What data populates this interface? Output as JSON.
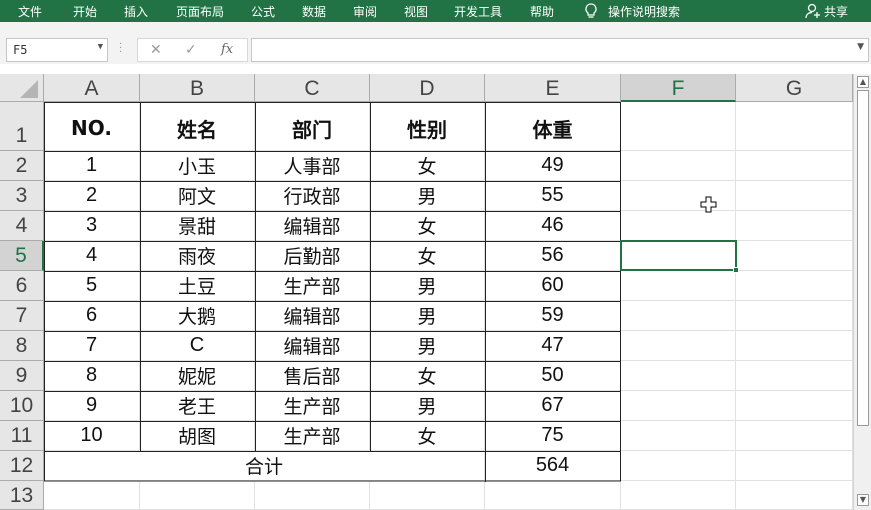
{
  "ribbon": {
    "tabs": [
      "文件",
      "开始",
      "插入",
      "页面布局",
      "公式",
      "数据",
      "审阅",
      "视图",
      "开发工具",
      "帮助"
    ],
    "search_label": "操作说明搜索",
    "share_label": "共享"
  },
  "formula_bar": {
    "name_box": "F5",
    "cancel_glyph": "✕",
    "enter_glyph": "✓",
    "function_glyph": "fx",
    "formula": ""
  },
  "grid": {
    "columns": [
      "A",
      "B",
      "C",
      "D",
      "E",
      "F",
      "G"
    ],
    "rows": [
      "1",
      "2",
      "3",
      "4",
      "5",
      "6",
      "7",
      "8",
      "9",
      "10",
      "11",
      "12",
      "13"
    ],
    "selected_cell": "F5"
  },
  "table": {
    "headers": [
      "NO.",
      "姓名",
      "部门",
      "性别",
      "体重"
    ],
    "rows": [
      [
        "1",
        "小玉",
        "人事部",
        "女",
        "49"
      ],
      [
        "2",
        "阿文",
        "行政部",
        "男",
        "55"
      ],
      [
        "3",
        "景甜",
        "编辑部",
        "女",
        "46"
      ],
      [
        "4",
        "雨夜",
        "后勤部",
        "女",
        "56"
      ],
      [
        "5",
        "土豆",
        "生产部",
        "男",
        "60"
      ],
      [
        "6",
        "大鹅",
        "编辑部",
        "男",
        "59"
      ],
      [
        "7",
        "C",
        "编辑部",
        "男",
        "47"
      ],
      [
        "8",
        "妮妮",
        "售后部",
        "女",
        "50"
      ],
      [
        "9",
        "老王",
        "生产部",
        "男",
        "67"
      ],
      [
        "10",
        "胡图",
        "生产部",
        "女",
        "75"
      ]
    ],
    "total_label": "合计",
    "total_value": "564"
  },
  "colors": {
    "accent": "#217346",
    "header_bg": "#e6e6e6",
    "gridline": "#e1e1e1"
  }
}
